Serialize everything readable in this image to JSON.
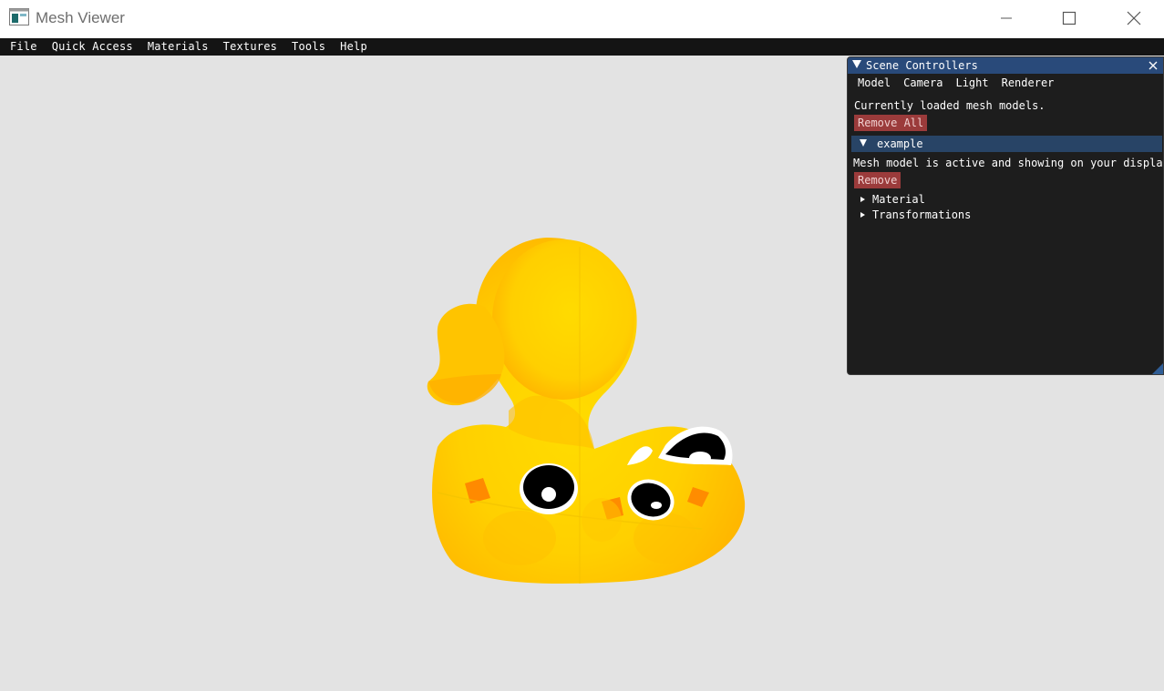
{
  "window": {
    "title": "Mesh Viewer",
    "icon": "app-window-icon",
    "controls": [
      "minimize-icon",
      "maximize-icon",
      "close-icon"
    ]
  },
  "menubar": {
    "items": [
      "File",
      "Quick Access",
      "Materials",
      "Textures",
      "Tools",
      "Help"
    ]
  },
  "viewport": {
    "background": "#e3e3e3",
    "model": "duck-mesh",
    "model_color": "#ffd200",
    "spot_color": "#000000"
  },
  "panel": {
    "title": "Scene Controllers",
    "tabs": [
      "Model",
      "Camera",
      "Light",
      "Renderer"
    ],
    "loaded_text": "Currently loaded mesh models.",
    "remove_all_label": "Remove All",
    "model_name": "example",
    "active_text": "Mesh model is active and showing on your display",
    "remove_label": "Remove",
    "tree_items": [
      "Material",
      "Transformations"
    ],
    "colors": {
      "title_bg": "#294a7a",
      "header_bg": "#284466",
      "button_bg": "#9b3b3b",
      "panel_bg": "#1d1d1d"
    }
  }
}
